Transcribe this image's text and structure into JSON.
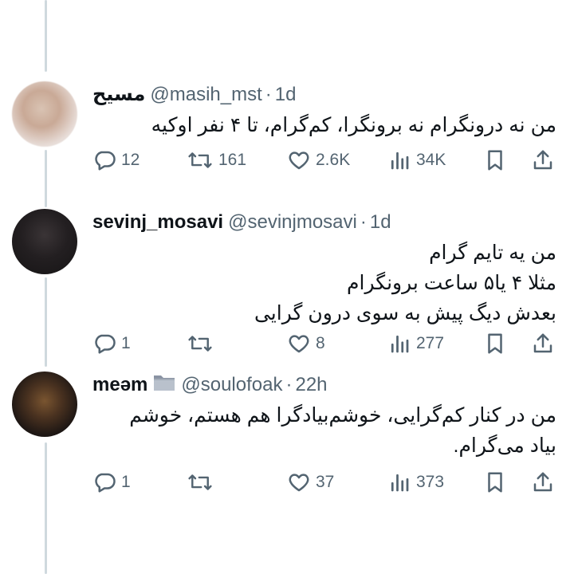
{
  "tweets": [
    {
      "name": "مسیح",
      "handle": "@masih_mst",
      "separator": "·",
      "time": "1d",
      "text": "من نه درونگرام نه برونگرا، کم‌گرام، تا ۴ نفر اوکیه",
      "replies": "12",
      "reposts": "161",
      "likes": "2.6K",
      "views": "34K"
    },
    {
      "name": "sevinj_mosavi",
      "handle": "@sevinjmosavi",
      "separator": "·",
      "time": "1d",
      "text": "من یه تایم گرام\nمثلا ۴ یا۵ ساعت برونگرام\nبعدش دیگ پیش به سوی درون گرایی",
      "replies": "1",
      "reposts": "",
      "likes": "8",
      "views": "277"
    },
    {
      "name": "meəm",
      "handle": "@soulofoak",
      "separator": "·",
      "time": "22h",
      "text": "من در کنار کم‌گرایی، خوشم‌بیادگرا هم هستم، خوشم\nبیاد می‌گرام.",
      "replies": "1",
      "reposts": "",
      "likes": "37",
      "views": "373"
    }
  ],
  "colors": {
    "text": "#0f1419",
    "secondary": "#536471",
    "thread_line": "#cfd9de",
    "background": "#ffffff"
  },
  "icons": [
    "reply-icon",
    "repost-icon",
    "like-icon",
    "views-icon",
    "bookmark-icon",
    "share-icon",
    "folder-icon"
  ]
}
